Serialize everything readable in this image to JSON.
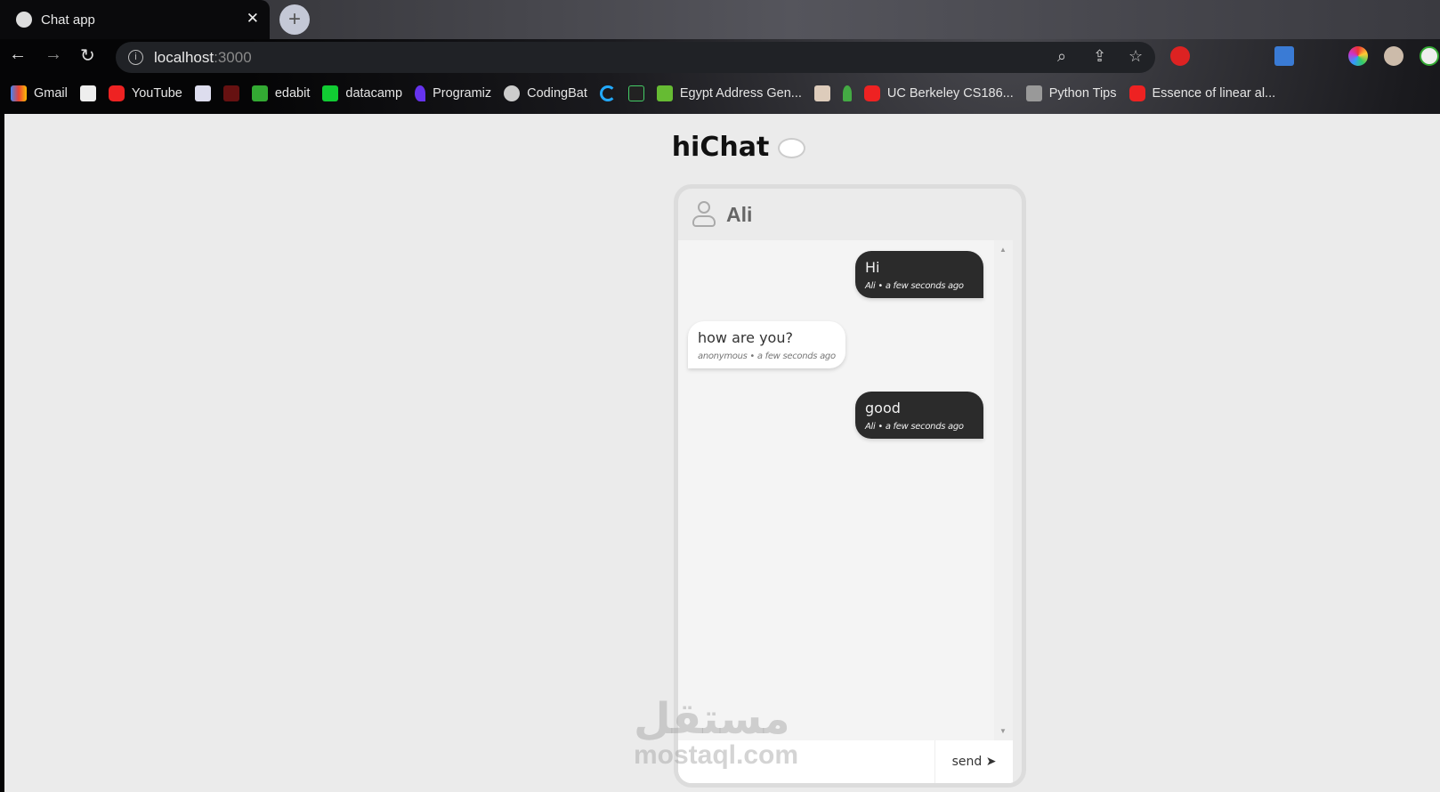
{
  "browser": {
    "tab_title": "Chat app",
    "url_host": "localhost",
    "url_port": ":3000",
    "bookmarks": [
      "Gmail",
      "YouTube",
      "edabit",
      "datacamp",
      "Programiz",
      "CodingBat",
      "Egypt Address Gen...",
      "UC Berkeley CS186...",
      "Python Tips",
      "Essence of linear al..."
    ]
  },
  "app": {
    "title": "hiChat",
    "chat_user": "Ali",
    "messages": [
      {
        "text": "Hi",
        "author": "Ali",
        "time": "a few seconds ago",
        "direction": "out"
      },
      {
        "text": "how are you?",
        "author": "anonymous",
        "time": "a few seconds ago",
        "direction": "in"
      },
      {
        "text": "good",
        "author": "Ali",
        "time": "a few seconds ago",
        "direction": "out"
      }
    ],
    "meta": [
      "Ali • a few seconds ago",
      "anonymous • a few seconds ago",
      "Ali • a few seconds ago"
    ],
    "input_value": "",
    "send_label": "send"
  },
  "watermark": {
    "arabic": "مستقل",
    "latin": "mostaql.com"
  },
  "colors": {
    "bubble_out": "#2b2b2b",
    "bubble_in": "#ffffff",
    "page_bg": "#ebebeb"
  }
}
